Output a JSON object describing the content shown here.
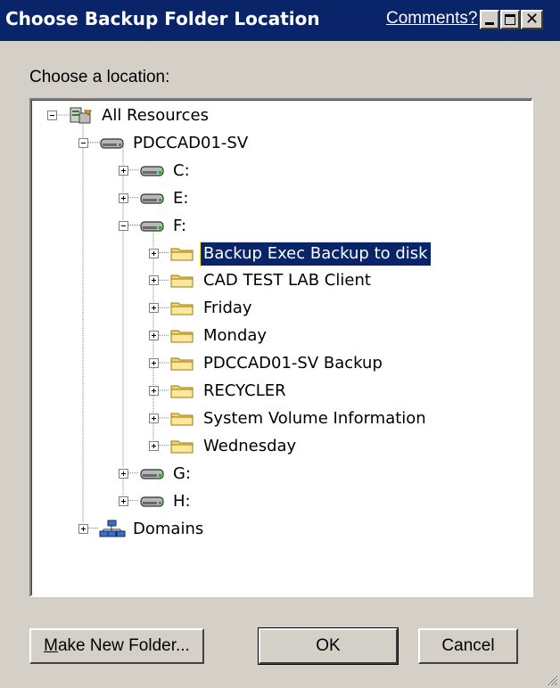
{
  "window": {
    "title": "Choose Backup Folder Location",
    "comments_link": "Comments?"
  },
  "prompt_label": "Choose a location:",
  "tree": [
    {
      "label": "All Resources",
      "icon": "all-resources-icon",
      "level": 0,
      "expander": "minus"
    },
    {
      "label": "PDCCAD01-SV",
      "icon": "server-icon",
      "level": 1,
      "expander": "minus"
    },
    {
      "label": "C:",
      "icon": "drive-icon",
      "level": 2,
      "expander": "plus"
    },
    {
      "label": "E:",
      "icon": "drive-icon",
      "level": 2,
      "expander": "plus"
    },
    {
      "label": "F:",
      "icon": "drive-icon",
      "level": 2,
      "expander": "minus"
    },
    {
      "label": "Backup Exec Backup to disk",
      "icon": "folder-icon",
      "level": 3,
      "expander": "plus",
      "selected": true
    },
    {
      "label": "CAD TEST LAB Client",
      "icon": "folder-icon",
      "level": 3,
      "expander": "plus"
    },
    {
      "label": "Friday",
      "icon": "folder-icon",
      "level": 3,
      "expander": "plus"
    },
    {
      "label": "Monday",
      "icon": "folder-icon",
      "level": 3,
      "expander": "plus"
    },
    {
      "label": "PDCCAD01-SV Backup",
      "icon": "folder-icon",
      "level": 3,
      "expander": "plus"
    },
    {
      "label": "RECYCLER",
      "icon": "folder-icon",
      "level": 3,
      "expander": "plus"
    },
    {
      "label": "System Volume Information",
      "icon": "folder-icon",
      "level": 3,
      "expander": "plus"
    },
    {
      "label": "Wednesday",
      "icon": "folder-icon",
      "level": 3,
      "expander": "plus"
    },
    {
      "label": "G:",
      "icon": "drive-icon",
      "level": 2,
      "expander": "plus"
    },
    {
      "label": "H:",
      "icon": "drive-icon",
      "level": 2,
      "expander": "plus"
    },
    {
      "label": "Domains",
      "icon": "domains-icon",
      "level": 1,
      "expander": "plus"
    }
  ],
  "buttons": {
    "make_new_folder": "Make New Folder...",
    "ok": "OK",
    "cancel": "Cancel"
  },
  "colors": {
    "titlebar": "#0a246a",
    "dialog_bg": "#d4d0c8",
    "selection": "#0a246a"
  }
}
